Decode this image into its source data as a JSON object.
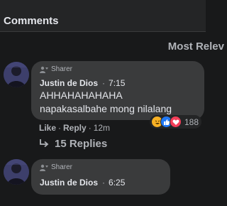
{
  "header": {
    "title": "Comments"
  },
  "sort": {
    "label": "Most Relev"
  },
  "comments": [
    {
      "role": "Sharer",
      "author": "Justin de Dios",
      "dot": "·",
      "time": "7:15",
      "lines": [
        "AHHAHAHAHAHA",
        "napakasalbahe mong nilalang"
      ],
      "reaction_count": "188",
      "reactions": [
        "haha-icon",
        "like-icon",
        "love-icon"
      ],
      "actions": {
        "like": "Like",
        "reply": "Reply",
        "sep": "·",
        "age": "12m"
      },
      "replies": "15 Replies"
    },
    {
      "role": "Sharer",
      "author": "Justin de Dios",
      "dot": "·",
      "time": "6:25"
    }
  ]
}
